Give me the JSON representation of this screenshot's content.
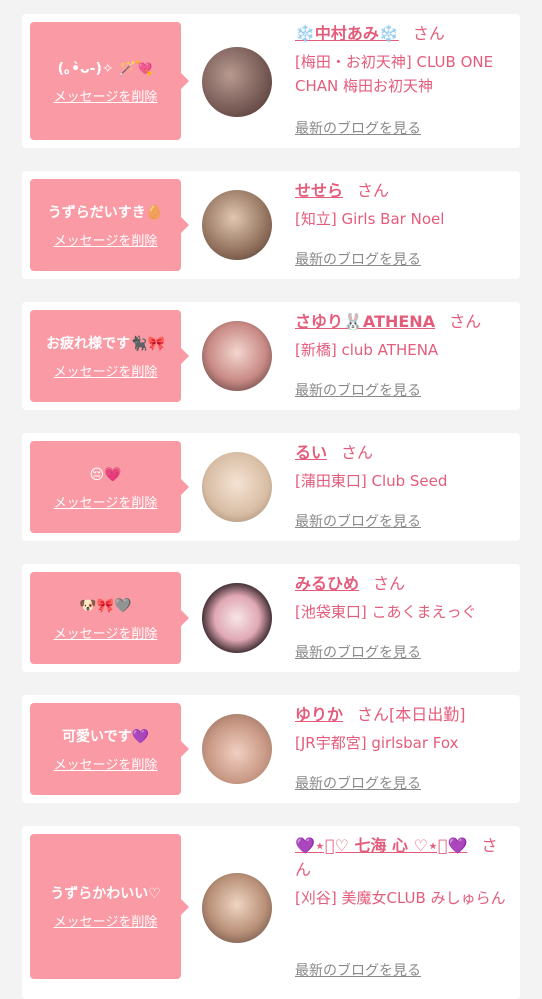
{
  "suffix": "さん",
  "delete_label": "メッセージを削除",
  "blog_label": "最新のブログを見る",
  "colors": {
    "accent": "#e45c7b",
    "bubble": "#f99aa5",
    "link_gray": "#8a8a8a"
  },
  "cards": [
    {
      "message": "(｡•̀ᴗ-)✧ 🪄💘",
      "name": "❄️中村あみ❄️",
      "name_extra": "",
      "shop": "[梅田・お初天神] CLUB ONE CHAN 梅田お初天神"
    },
    {
      "message": "うずらだいすき🥚",
      "name": "せせら",
      "name_extra": "",
      "shop": "[知立] Girls Bar Noel"
    },
    {
      "message": "お疲れ様です🐈‍⬛🎀",
      "name": "さゆり🐰ATHENA",
      "name_extra": "",
      "shop": "[新橋] club ATHENA"
    },
    {
      "message": "😔💗",
      "name": "るい",
      "name_extra": "",
      "shop": "[蒲田東口] Club Seed"
    },
    {
      "message": "🐶🎀🩶",
      "name": "みるひめ",
      "name_extra": "",
      "shop": "[池袋東口] こあくまえっぐ"
    },
    {
      "message": "可愛いです💜",
      "name": "ゆりか",
      "name_extra": "[本日出勤]",
      "shop": "[JR宇都宮] girlsbar Fox"
    },
    {
      "message": "うずらかわいい♡",
      "name": "💜⋆͛♡ 七海 心 ♡⋆͛💜",
      "name_extra": "",
      "shop": "[刈谷] 美魔女CLUB みしゅらん"
    }
  ]
}
